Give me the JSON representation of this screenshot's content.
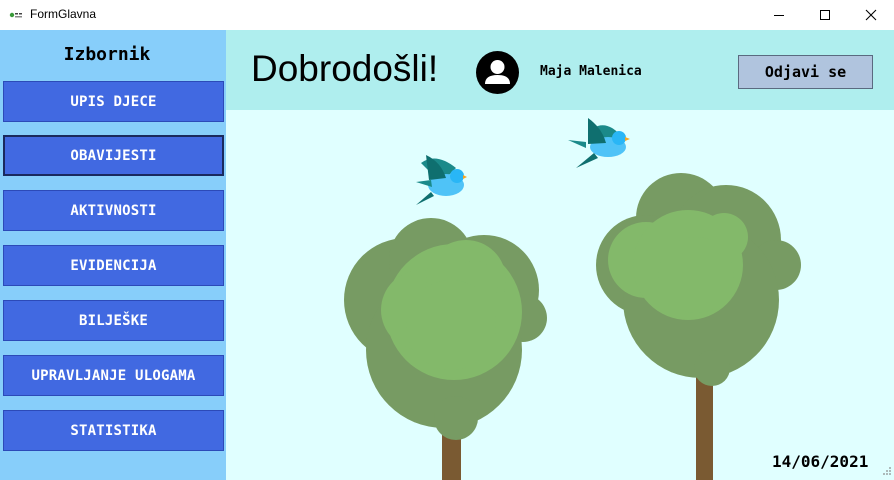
{
  "window": {
    "title": "FormGlavna",
    "icon": "form-app-icon",
    "controls": [
      "minimize-icon",
      "maximize-icon",
      "close-icon"
    ]
  },
  "sidebar": {
    "title": "Izbornik",
    "background": "#87cefa",
    "button_color": "#4169e1",
    "items": [
      {
        "label": "UPIS DJECE"
      },
      {
        "label": "OBAVIJESTI",
        "selected": true
      },
      {
        "label": "AKTIVNOSTI"
      },
      {
        "label": "EVIDENCIJA"
      },
      {
        "label": "BILJEŠKE"
      },
      {
        "label": "UPRAVLJANJE ULOGAMA"
      },
      {
        "label": "STATISTIKA"
      }
    ]
  },
  "header": {
    "welcome": "Dobrodošli!",
    "avatar_icon": "user-avatar-icon",
    "username": "Maja Malenica",
    "logout_label": "Odjavi se",
    "background": "#afeeee"
  },
  "main": {
    "background": "#e0ffff",
    "date": "14/06/2021",
    "illustration": [
      "tree",
      "tree",
      "bird",
      "bird"
    ]
  }
}
